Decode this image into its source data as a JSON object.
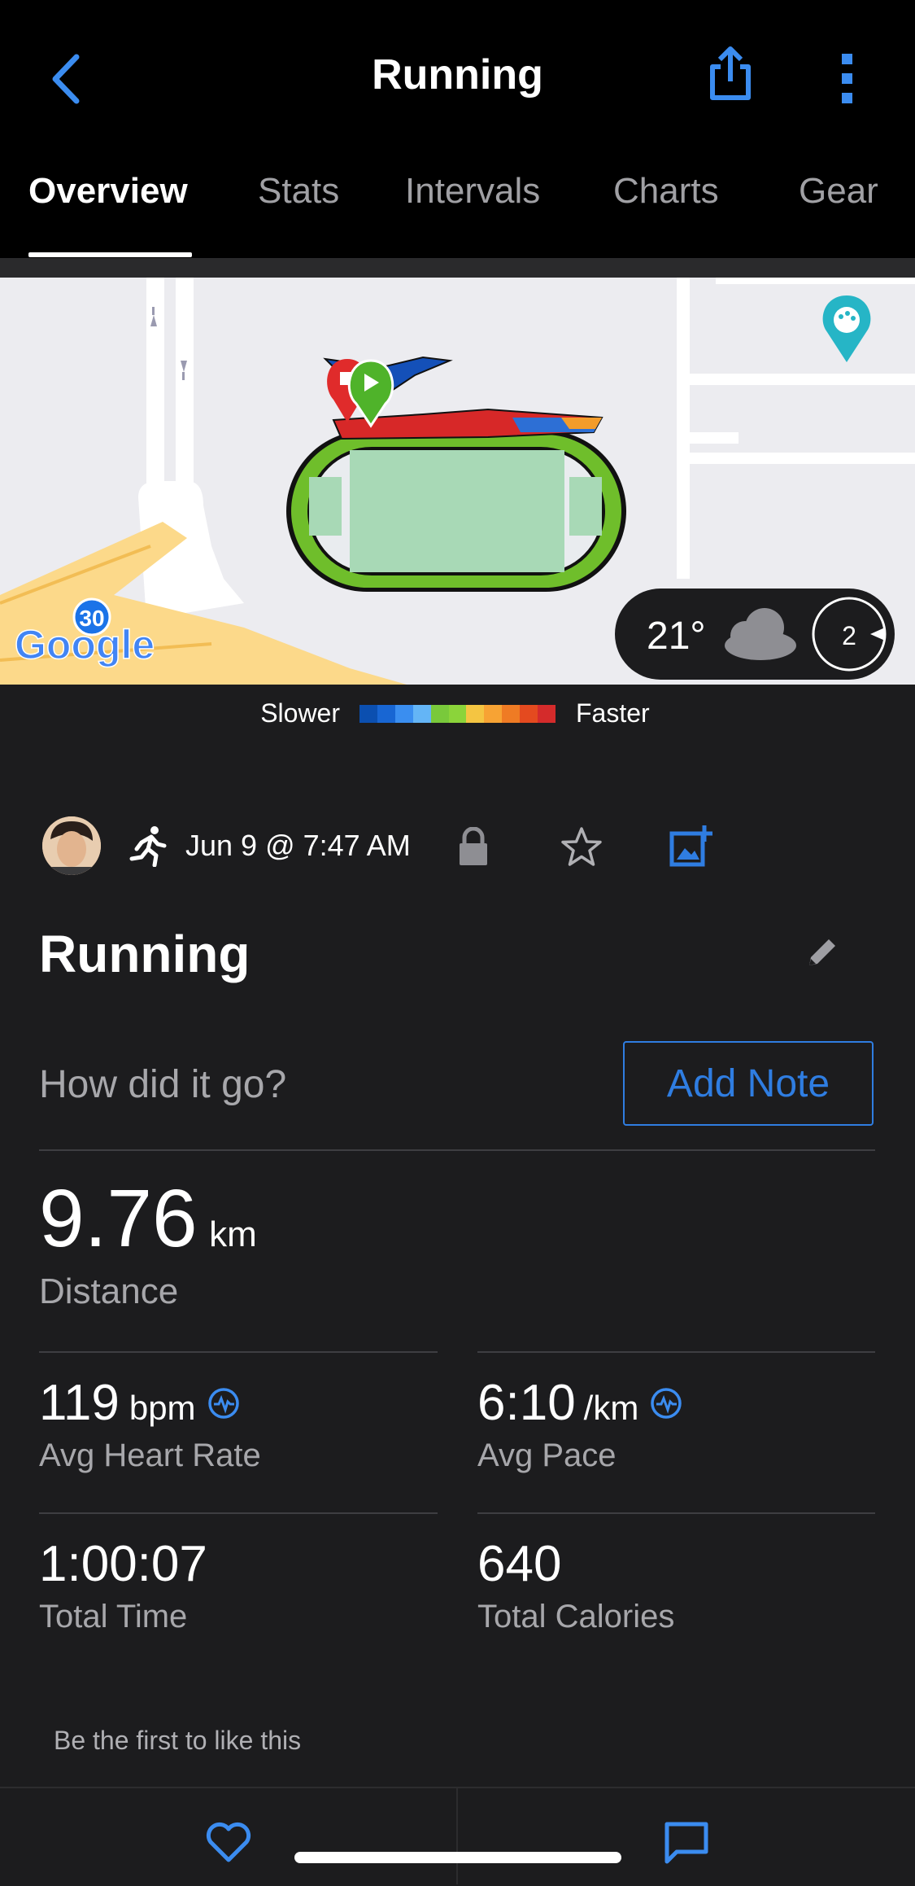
{
  "header": {
    "title": "Running",
    "back_icon": "chevron-left-icon",
    "share_icon": "share-icon",
    "more_icon": "more-vertical-icon"
  },
  "tabs": [
    {
      "label": "Overview",
      "active": true
    },
    {
      "label": "Stats",
      "active": false
    },
    {
      "label": "Intervals",
      "active": false
    },
    {
      "label": "Charts",
      "active": false
    },
    {
      "label": "Gear",
      "active": false
    }
  ],
  "map": {
    "road_marker": "30",
    "google_logo": "Google",
    "weather": {
      "temperature": "21°",
      "icon": "cloud-icon",
      "wind": "2"
    }
  },
  "pace_legend": {
    "slower_label": "Slower",
    "faster_label": "Faster",
    "colors": [
      "#0b4fb0",
      "#1866d3",
      "#3a8ef0",
      "#64b5f6",
      "#79c93b",
      "#8bd43a",
      "#f4c542",
      "#f7a334",
      "#ef7b24",
      "#e44a1f",
      "#d42b2b"
    ]
  },
  "activity": {
    "date": "Jun 9 @ 7:47 AM",
    "name": "Running",
    "note_prompt": "How did it go?",
    "add_note_label": "Add Note"
  },
  "stats": {
    "distance": {
      "value": "9.76",
      "unit": "km",
      "label": "Distance"
    },
    "heart_rate": {
      "value": "119",
      "unit": "bpm",
      "label": "Avg Heart Rate"
    },
    "pace": {
      "value": "6:10",
      "unit": "/km",
      "label": "Avg Pace"
    },
    "time": {
      "value": "1:00:07",
      "label": "Total Time"
    },
    "calories": {
      "value": "640",
      "label": "Total Calories"
    }
  },
  "social": {
    "likes_text": "Be the first to like this"
  },
  "colors": {
    "accent": "#2f7de1",
    "background": "#1c1c1e",
    "header": "#000000"
  }
}
